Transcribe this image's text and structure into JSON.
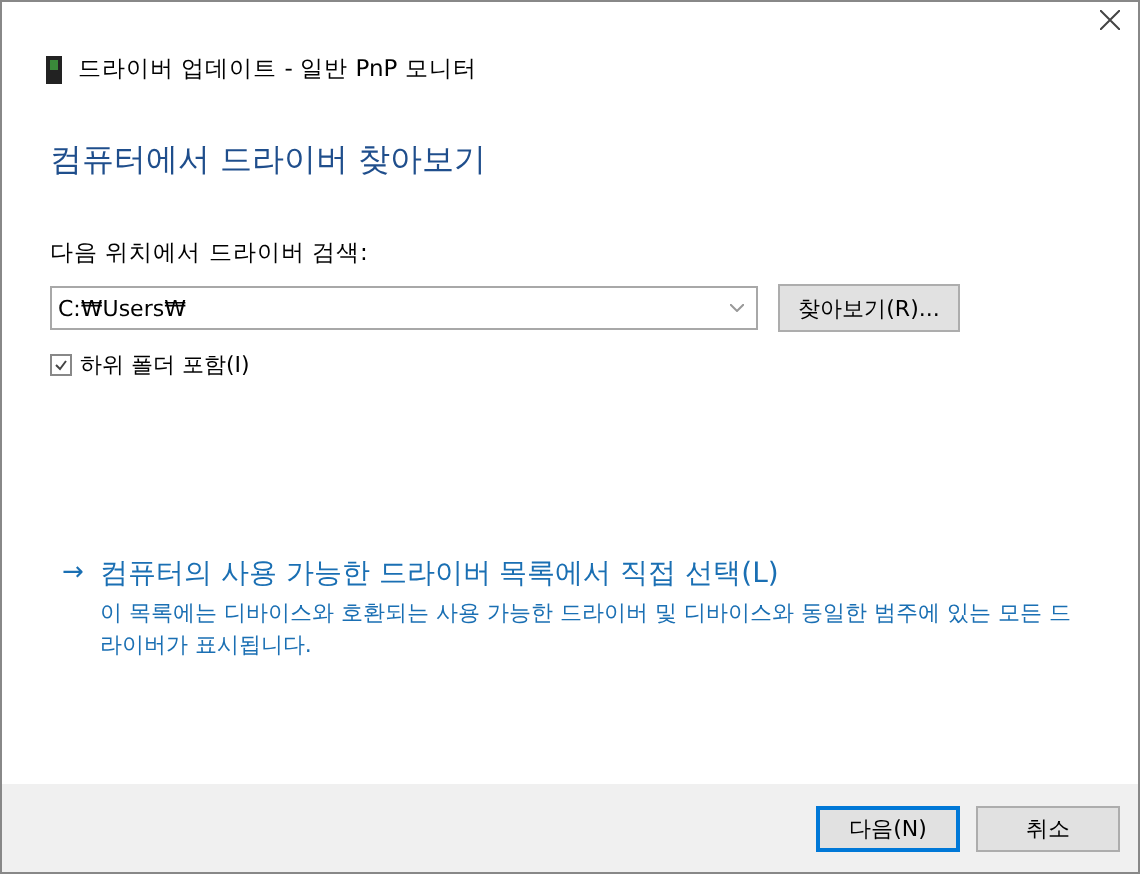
{
  "window": {
    "title": "드라이버 업데이트 - 일반 PnP 모니터"
  },
  "heading": "컴퓨터에서 드라이버 찾아보기",
  "search": {
    "label": "다음 위치에서 드라이버 검색:",
    "value": "C:₩Users₩",
    "browse_button": "찾아보기(R)...",
    "include_subfolders": {
      "label": "하위 폴더 포함(I)",
      "checked": true
    }
  },
  "pick_link": {
    "arrow": "→",
    "label": "컴퓨터의 사용 가능한 드라이버 목록에서 직접 선택(L)",
    "description": "이 목록에는 디바이스와 호환되는 사용 가능한 드라이버 및 디바이스와 동일한 범주에 있는 모든 드라이버가 표시됩니다."
  },
  "buttons": [
    {
      "label": "다음(N)",
      "default": true
    },
    {
      "label": "취소",
      "default": false
    }
  ]
}
